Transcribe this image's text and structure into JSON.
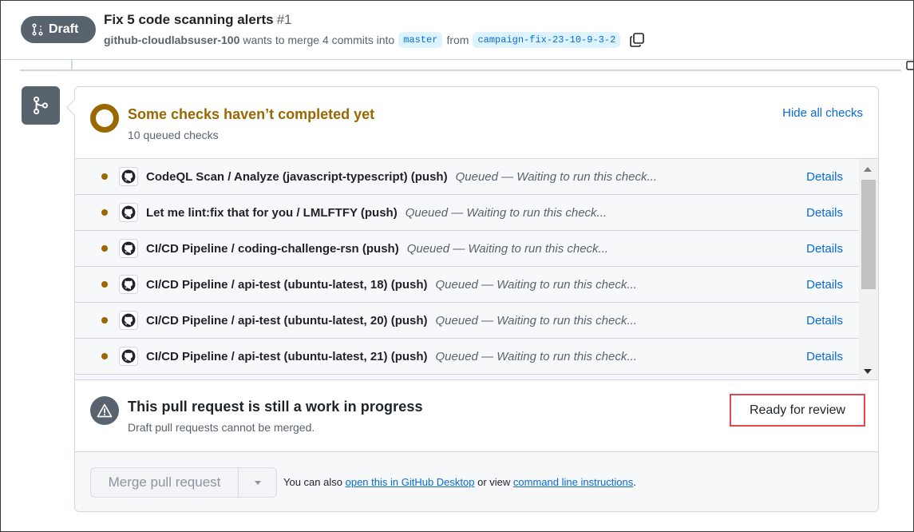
{
  "header": {
    "badge_label": "Draft",
    "title": "Fix 5 code scanning alerts",
    "number": "#1",
    "author": "github-cloudlabsuser-100",
    "merge_text": "wants to merge 4 commits into",
    "base_branch": "master",
    "from_text": "from",
    "head_branch": "campaign-fix-23-10-9-3-2"
  },
  "checks": {
    "title": "Some checks haven’t completed yet",
    "subtitle": "10 queued checks",
    "toggle_label": "Hide all checks",
    "items": [
      {
        "name": "CodeQL Scan / Analyze (javascript-typescript) (push)",
        "status": "Queued — Waiting to run this check...",
        "details": "Details"
      },
      {
        "name": "Let me lint:fix that for you / LMLFTFY (push)",
        "status": "Queued — Waiting to run this check...",
        "details": "Details"
      },
      {
        "name": "CI/CD Pipeline / coding-challenge-rsn (push)",
        "status": "Queued — Waiting to run this check...",
        "details": "Details"
      },
      {
        "name": "CI/CD Pipeline / api-test (ubuntu-latest, 18) (push)",
        "status": "Queued — Waiting to run this check...",
        "details": "Details"
      },
      {
        "name": "CI/CD Pipeline / api-test (ubuntu-latest, 20) (push)",
        "status": "Queued — Waiting to run this check...",
        "details": "Details"
      },
      {
        "name": "CI/CD Pipeline / api-test (ubuntu-latest, 21) (push)",
        "status": "Queued — Waiting to run this check...",
        "details": "Details"
      }
    ]
  },
  "wip": {
    "title": "This pull request is still a work in progress",
    "subtitle": "Draft pull requests cannot be merged.",
    "ready_label": "Ready for review"
  },
  "merge": {
    "button_label": "Merge pull request",
    "text_prefix": "You can also",
    "desktop_link": "open this in GitHub Desktop",
    "text_middle": "or view",
    "cli_link": "command line instructions",
    "text_suffix": "."
  },
  "colors": {
    "pending": "#9a6700",
    "link": "#0969da",
    "highlight_border": "#e5474e",
    "badge_bg": "#59636e"
  }
}
